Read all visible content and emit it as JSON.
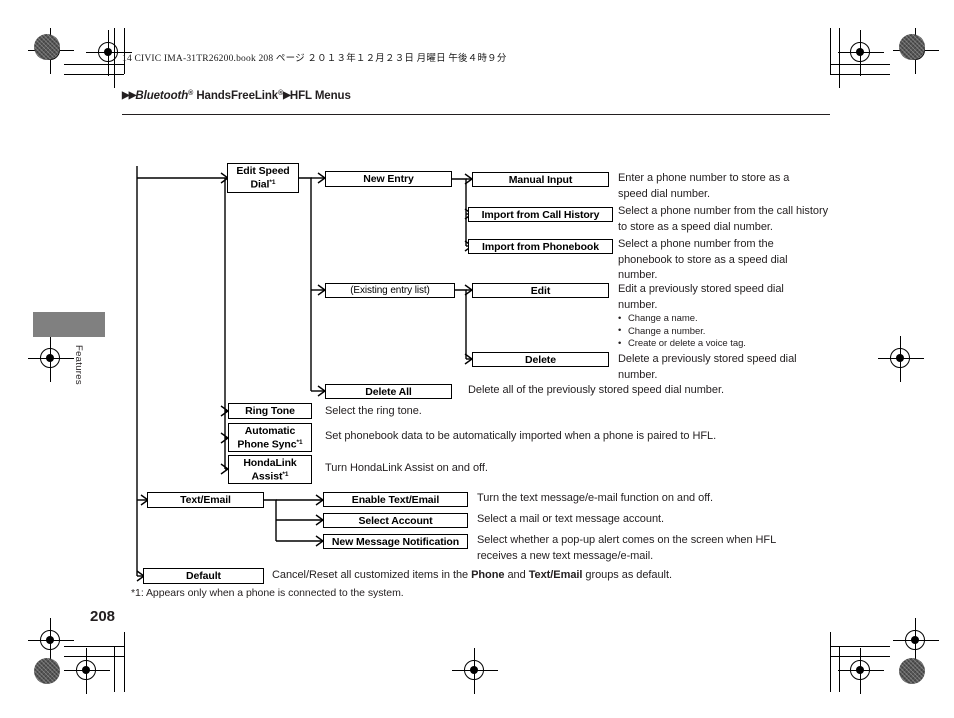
{
  "header": {
    "book_info": "14 CIVIC IMA-31TR26200.book   208 ページ   ２０１３年１２月２３日   月曜日   午後４時９分",
    "breadcrumb_bluetooth": "Bluetooth",
    "breadcrumb_handsfreelink": "HandsFreeLink",
    "breadcrumb_section": "HFL Menus",
    "registered_mark": "®",
    "triangle": "▶▶",
    "triangle_single": "▶"
  },
  "sidebar": {
    "tab_label": "Features"
  },
  "page": {
    "number": "208",
    "footnote": "*1: Appears only when a phone is connected to the system."
  },
  "diagram": {
    "footnote_marker": "*1",
    "nodes": {
      "edit_speed_dial": "Edit Speed Dial",
      "new_entry": "New Entry",
      "manual_input": "Manual Input",
      "import_call_history": "Import from Call History",
      "import_phonebook": "Import from Phonebook",
      "existing_entry_list": "(Existing entry list)",
      "edit": "Edit",
      "delete": "Delete",
      "delete_all": "Delete All",
      "ring_tone": "Ring Tone",
      "automatic_phone_sync": "Automatic Phone Sync",
      "hondalink_assist": "HondaLink Assist",
      "text_email": "Text/Email",
      "enable_text_email": "Enable Text/Email",
      "select_account": "Select Account",
      "new_message_notification": "New Message Notification",
      "default": "Default"
    },
    "descriptions": {
      "manual_input": "Enter a phone number to store as a speed dial number.",
      "import_call_history": "Select a phone number from the call history to store as a speed dial number.",
      "import_phonebook": "Select a phone number from the phonebook to store as a speed dial number.",
      "edit": "Edit a previously stored speed dial number.",
      "edit_bullets": [
        "Change a name.",
        "Change a number.",
        "Create or delete a voice tag."
      ],
      "delete": "Delete a previously stored speed dial number.",
      "delete_all": "Delete all of the previously stored speed dial number.",
      "ring_tone": "Select the ring tone.",
      "automatic_phone_sync": "Set phonebook data to be automatically imported when a phone is paired to HFL.",
      "hondalink_assist": "Turn HondaLink Assist on and off.",
      "enable_text_email": "Turn the text message/e-mail function on and off.",
      "select_account": "Select a mail or text message account.",
      "new_message_notification": "Select whether a pop-up alert comes on the screen when HFL receives a new text message/e-mail.",
      "default_prefix": "Cancel/Reset all customized items in the ",
      "default_bold1": "Phone",
      "default_mid": " and ",
      "default_bold2": "Text/Email",
      "default_suffix": " groups as default."
    }
  },
  "colors": {
    "ink": "#231f20",
    "tab_gray": "#808080",
    "line": "#000000"
  }
}
